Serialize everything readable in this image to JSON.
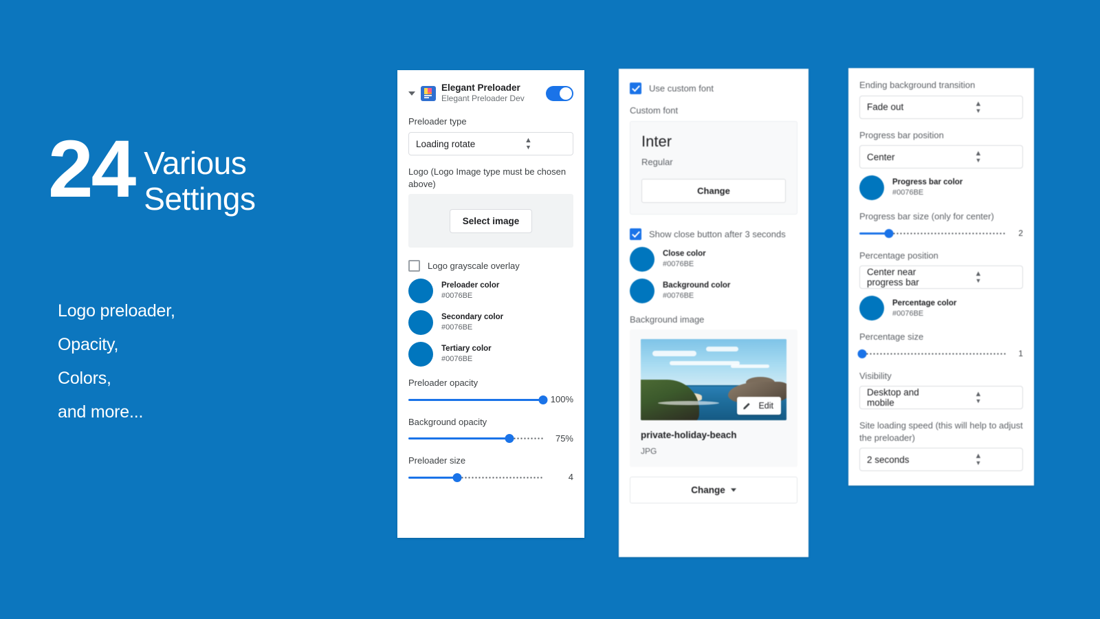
{
  "promo": {
    "number": "24",
    "headline_line1": "Various",
    "headline_line2": "Settings",
    "features": [
      "Logo preloader,",
      "Opacity,",
      "Colors,",
      "and more..."
    ],
    "background_color": "#0C76BE"
  },
  "panel1": {
    "app_name": "Elegant Preloader",
    "app_subtitle": "Elegant Preloader Dev",
    "toggle_on": true,
    "preloader_type_label": "Preloader type",
    "preloader_type_value": "Loading rotate",
    "logo_label": "Logo (Logo Image type must be chosen above)",
    "select_image_button": "Select image",
    "grayscale_checkbox_label": "Logo grayscale overlay",
    "grayscale_checked": false,
    "colors": [
      {
        "name": "Preloader color",
        "hex": "#0076BE"
      },
      {
        "name": "Secondary color",
        "hex": "#0076BE"
      },
      {
        "name": "Tertiary color",
        "hex": "#0076BE"
      }
    ],
    "sliders": [
      {
        "label": "Preloader opacity",
        "value": "100%",
        "percent": 100
      },
      {
        "label": "Background opacity",
        "value": "75%",
        "percent": 75
      },
      {
        "label": "Preloader size",
        "value": "4",
        "percent": 36
      }
    ]
  },
  "panel2": {
    "custom_font_checkbox_label": "Use custom font",
    "custom_font_checked": true,
    "custom_font_label": "Custom font",
    "font_name": "Inter",
    "font_weight": "Regular",
    "font_change_button": "Change",
    "close_button_checkbox_label": "Show close button after 3 seconds",
    "close_button_checked": true,
    "colors": [
      {
        "name": "Close color",
        "hex": "#0076BE"
      },
      {
        "name": "Background color",
        "hex": "#0076BE"
      }
    ],
    "background_image_label": "Background image",
    "image_edit_button": "Edit",
    "image_name": "private-holiday-beach",
    "image_type": "JPG",
    "change_button": "Change"
  },
  "panel3": {
    "transition_label": "Ending background transition",
    "transition_value": "Fade out",
    "progress_position_label": "Progress bar position",
    "progress_position_value": "Center",
    "progress_color": {
      "name": "Progress bar color",
      "hex": "#0076BE"
    },
    "progress_size_label": "Progress bar size (only for center)",
    "progress_size_value": "2",
    "progress_size_percent": 20,
    "percentage_position_label": "Percentage position",
    "percentage_position_value": "Center near progress bar",
    "percentage_color": {
      "name": "Percentage color",
      "hex": "#0076BE"
    },
    "percentage_size_label": "Percentage size",
    "percentage_size_value": "1",
    "percentage_size_percent": 2,
    "visibility_label": "Visibility",
    "visibility_value": "Desktop and mobile",
    "loading_speed_label": "Site loading speed (this will help to adjust the preloader)",
    "loading_speed_value": "2 seconds"
  }
}
